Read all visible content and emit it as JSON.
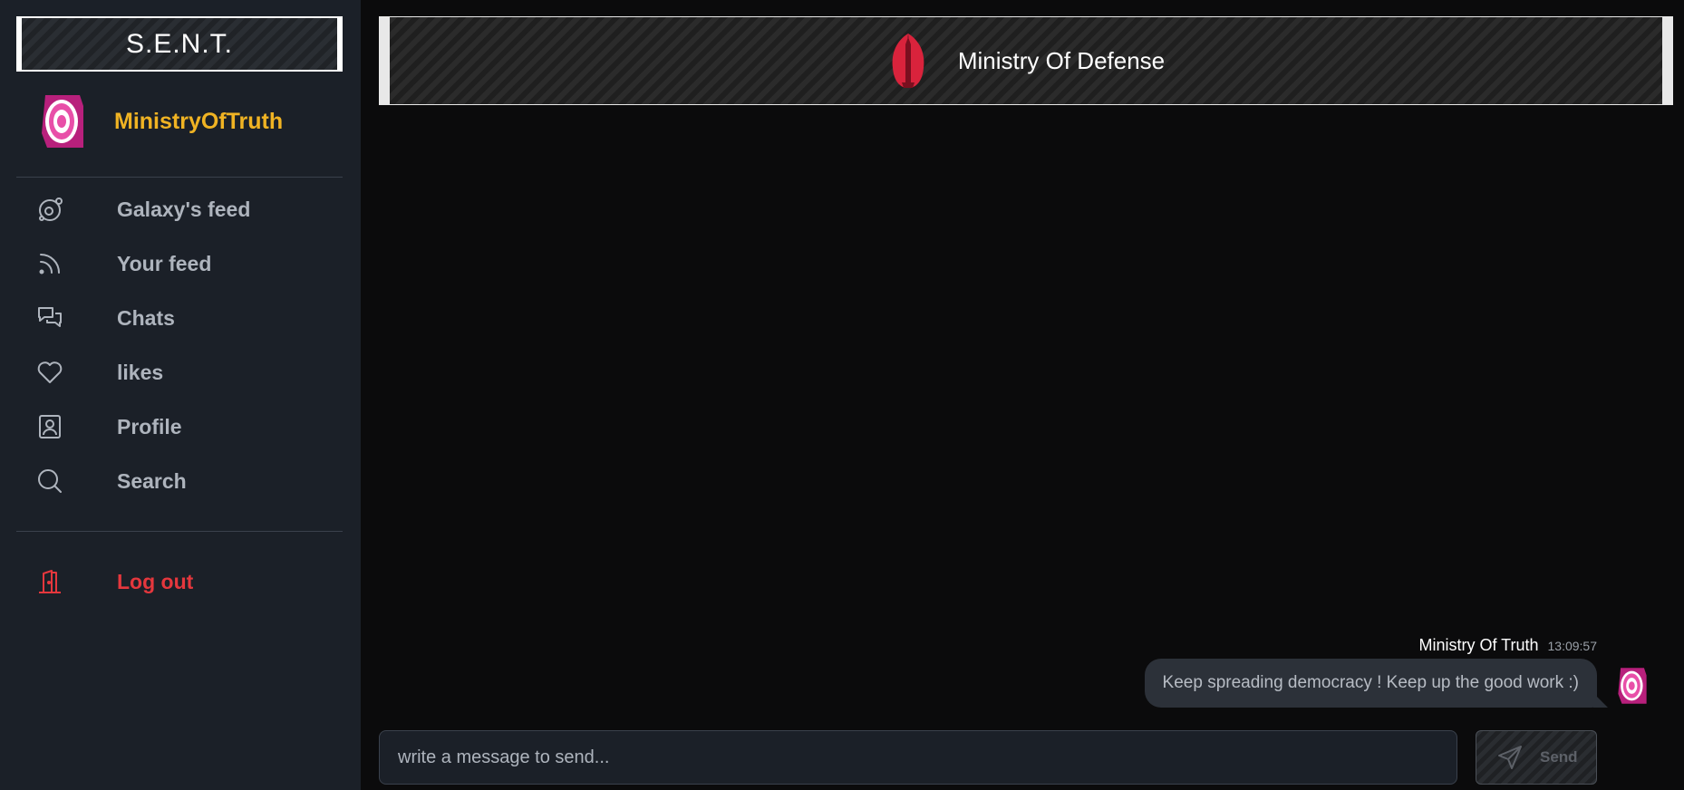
{
  "app": {
    "brand": "S.E.N.T."
  },
  "user": {
    "name": "MinistryOfTruth",
    "avatar_icon": "target-avatar-icon"
  },
  "sidebar": {
    "items": [
      {
        "label": "Galaxy's feed",
        "icon": "orbit-icon"
      },
      {
        "label": "Your feed",
        "icon": "rss-icon"
      },
      {
        "label": "Chats",
        "icon": "chat-bubbles-icon"
      },
      {
        "label": "likes",
        "icon": "heart-icon"
      },
      {
        "label": "Profile",
        "icon": "profile-card-icon"
      },
      {
        "label": "Search",
        "icon": "search-icon"
      }
    ],
    "logout": {
      "label": "Log out",
      "icon": "door-exit-icon"
    }
  },
  "chat": {
    "title": "Ministry Of Defense",
    "logo_icon": "rocket-logo-icon",
    "messages": [
      {
        "author": "Ministry Of Truth",
        "time": "13:09:57",
        "text": "Keep spreading democracy ! Keep up the good work :)"
      }
    ],
    "input_placeholder": "write a message to send...",
    "send_label": "Send"
  },
  "colors": {
    "accent_username": "#f0b323",
    "logout": "#e5373d",
    "avatar_pink": "#e84fa8",
    "logo_red": "#d9233c"
  }
}
